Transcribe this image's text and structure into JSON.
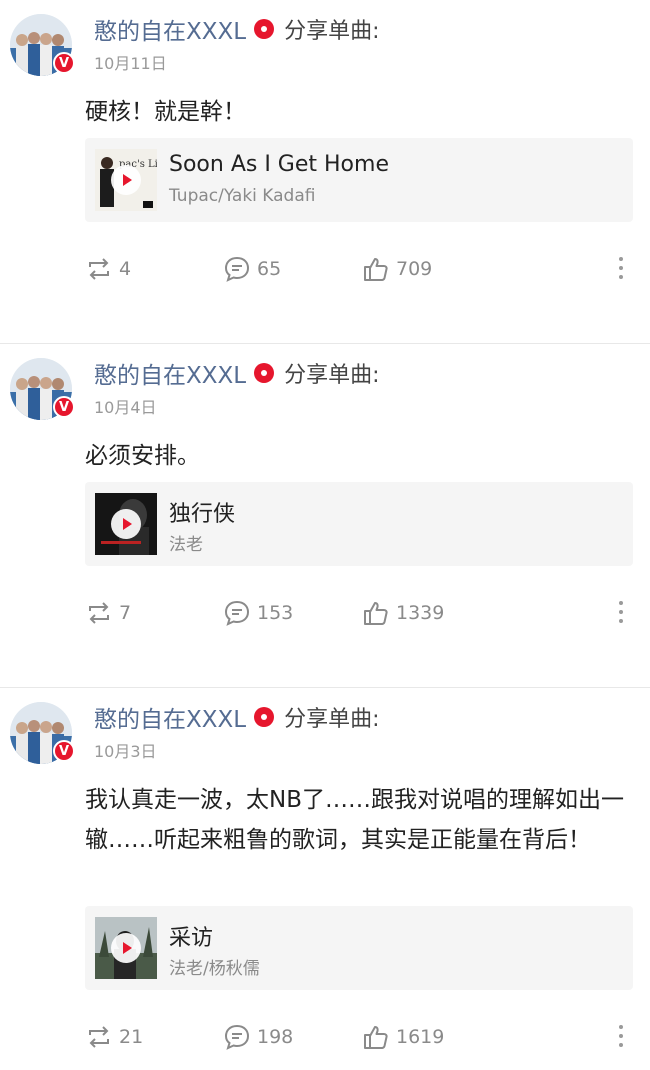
{
  "posts": [
    {
      "username": "憨的自在XXXL",
      "action": "分享单曲:",
      "date": "10月11日",
      "content": "硬核！就是幹！",
      "song": {
        "title": "Soon As I Get Home",
        "artist": "Tupac/Yaki Kadafi",
        "cover_text": "pac's Life"
      },
      "reposts": "4",
      "comments": "65",
      "likes": "709"
    },
    {
      "username": "憨的自在XXXL",
      "action": "分享单曲:",
      "date": "10月4日",
      "content": "必须安排。",
      "song": {
        "title": "独行侠",
        "artist": "法老"
      },
      "reposts": "7",
      "comments": "153",
      "likes": "1339"
    },
    {
      "username": "憨的自在XXXL",
      "action": "分享单曲:",
      "date": "10月3日",
      "content": "我认真走一波，太NB了……跟我对说唱的理解如出一辙……听起来粗鲁的歌词，其实是正能量在背后！",
      "song": {
        "title": "采访",
        "artist": "法老/杨秋儒"
      },
      "reposts": "21",
      "comments": "198",
      "likes": "1619"
    }
  ],
  "badge": "V",
  "colors": {
    "username": "#556c92",
    "accent": "#e6162d",
    "muted": "#8a8a8a"
  }
}
